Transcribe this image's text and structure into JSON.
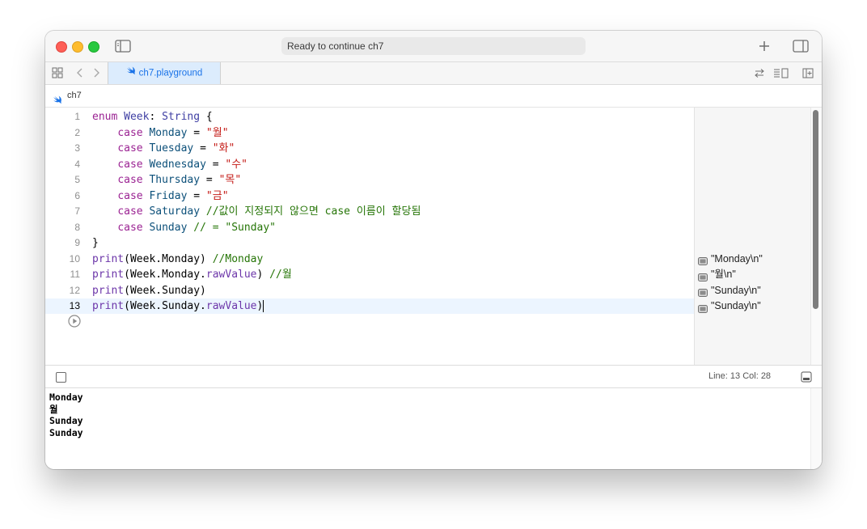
{
  "window": {
    "status": "Ready to continue ch7"
  },
  "tabs": [
    {
      "label": "ch7.playground",
      "active": true
    }
  ],
  "breadcrumb": {
    "item": "ch7"
  },
  "editor": {
    "lines": [
      {
        "n": "1",
        "tokens": [
          [
            "kw",
            "enum"
          ],
          [
            "t",
            " "
          ],
          [
            "ty",
            "Week"
          ],
          [
            "t",
            ": "
          ],
          [
            "ty",
            "String"
          ],
          [
            "t",
            " {"
          ]
        ]
      },
      {
        "n": "2",
        "tokens": [
          [
            "t",
            "    "
          ],
          [
            "kw",
            "case"
          ],
          [
            "t",
            " "
          ],
          [
            "id",
            "Monday"
          ],
          [
            "t",
            " = "
          ],
          [
            "str",
            "\"월\""
          ]
        ]
      },
      {
        "n": "3",
        "tokens": [
          [
            "t",
            "    "
          ],
          [
            "kw",
            "case"
          ],
          [
            "t",
            " "
          ],
          [
            "id",
            "Tuesday"
          ],
          [
            "t",
            " = "
          ],
          [
            "str",
            "\"화\""
          ]
        ]
      },
      {
        "n": "4",
        "tokens": [
          [
            "t",
            "    "
          ],
          [
            "kw",
            "case"
          ],
          [
            "t",
            " "
          ],
          [
            "id",
            "Wednesday"
          ],
          [
            "t",
            " = "
          ],
          [
            "str",
            "\"수\""
          ]
        ]
      },
      {
        "n": "5",
        "tokens": [
          [
            "t",
            "    "
          ],
          [
            "kw",
            "case"
          ],
          [
            "t",
            " "
          ],
          [
            "id",
            "Thursday"
          ],
          [
            "t",
            " = "
          ],
          [
            "str",
            "\"목\""
          ]
        ]
      },
      {
        "n": "6",
        "tokens": [
          [
            "t",
            "    "
          ],
          [
            "kw",
            "case"
          ],
          [
            "t",
            " "
          ],
          [
            "id",
            "Friday"
          ],
          [
            "t",
            " = "
          ],
          [
            "str",
            "\"금\""
          ]
        ]
      },
      {
        "n": "7",
        "tokens": [
          [
            "t",
            "    "
          ],
          [
            "kw",
            "case"
          ],
          [
            "t",
            " "
          ],
          [
            "id",
            "Saturday"
          ],
          [
            "t",
            " "
          ],
          [
            "cm",
            "//값이 지정되지 않으면 case 이름이 할당됨"
          ]
        ]
      },
      {
        "n": "8",
        "tokens": [
          [
            "t",
            "    "
          ],
          [
            "kw",
            "case"
          ],
          [
            "t",
            " "
          ],
          [
            "id",
            "Sunday"
          ],
          [
            "t",
            " "
          ],
          [
            "cm",
            "// = \"Sunday\""
          ]
        ]
      },
      {
        "n": "9",
        "tokens": [
          [
            "t",
            "}"
          ]
        ]
      },
      {
        "n": "10",
        "tokens": [
          [
            "fn",
            "print"
          ],
          [
            "t",
            "(Week.Monday) "
          ],
          [
            "cm",
            "//Monday"
          ]
        ]
      },
      {
        "n": "11",
        "tokens": [
          [
            "fn",
            "print"
          ],
          [
            "t",
            "(Week.Monday."
          ],
          [
            "fn",
            "rawValue"
          ],
          [
            "t",
            ") "
          ],
          [
            "cm",
            "//월"
          ]
        ]
      },
      {
        "n": "12",
        "tokens": [
          [
            "fn",
            "print"
          ],
          [
            "t",
            "(Week.Sunday)"
          ]
        ]
      },
      {
        "n": "13",
        "tokens": [
          [
            "fn",
            "print"
          ],
          [
            "t",
            "(Week.Sunday."
          ],
          [
            "fn",
            "rawValue"
          ],
          [
            "t",
            ")"
          ]
        ],
        "current": true
      }
    ]
  },
  "results": [
    {
      "line": 10,
      "text": "\"Monday\\n\""
    },
    {
      "line": 11,
      "text": "\"월\\n\""
    },
    {
      "line": 12,
      "text": "\"Sunday\\n\""
    },
    {
      "line": 13,
      "text": "\"Sunday\\n\""
    }
  ],
  "debug": {
    "position": "Line: 13  Col: 28"
  },
  "console": {
    "lines": [
      "Monday",
      "월",
      "Sunday",
      "Sunday"
    ]
  }
}
